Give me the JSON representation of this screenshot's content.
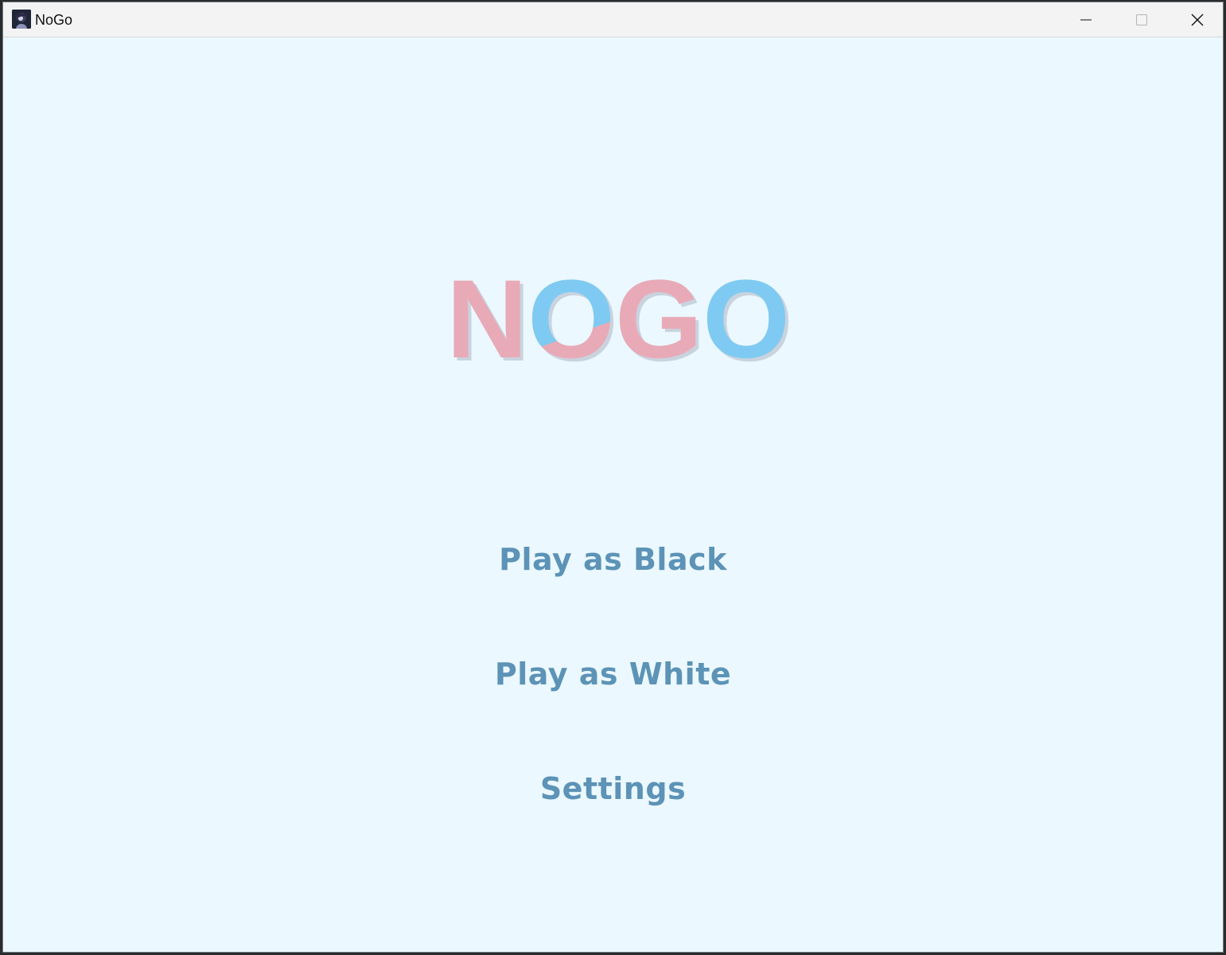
{
  "window": {
    "title": "NoGo"
  },
  "logo": {
    "text": "NOGO",
    "colors": {
      "pink": "#e8aab7",
      "blue": "#7fcaf2",
      "shadow": "#c8d2dc"
    }
  },
  "menu": {
    "items": [
      {
        "label": "Play as Black"
      },
      {
        "label": "Play as White"
      },
      {
        "label": "Settings"
      }
    ]
  },
  "colors": {
    "background": "#ebf8ff",
    "menu_text": "#5c93b6",
    "titlebar": "#f3f3f3"
  },
  "icons": {
    "app": "app-avatar-icon",
    "minimize": "minimize-icon",
    "maximize": "maximize-icon",
    "close": "close-icon"
  }
}
